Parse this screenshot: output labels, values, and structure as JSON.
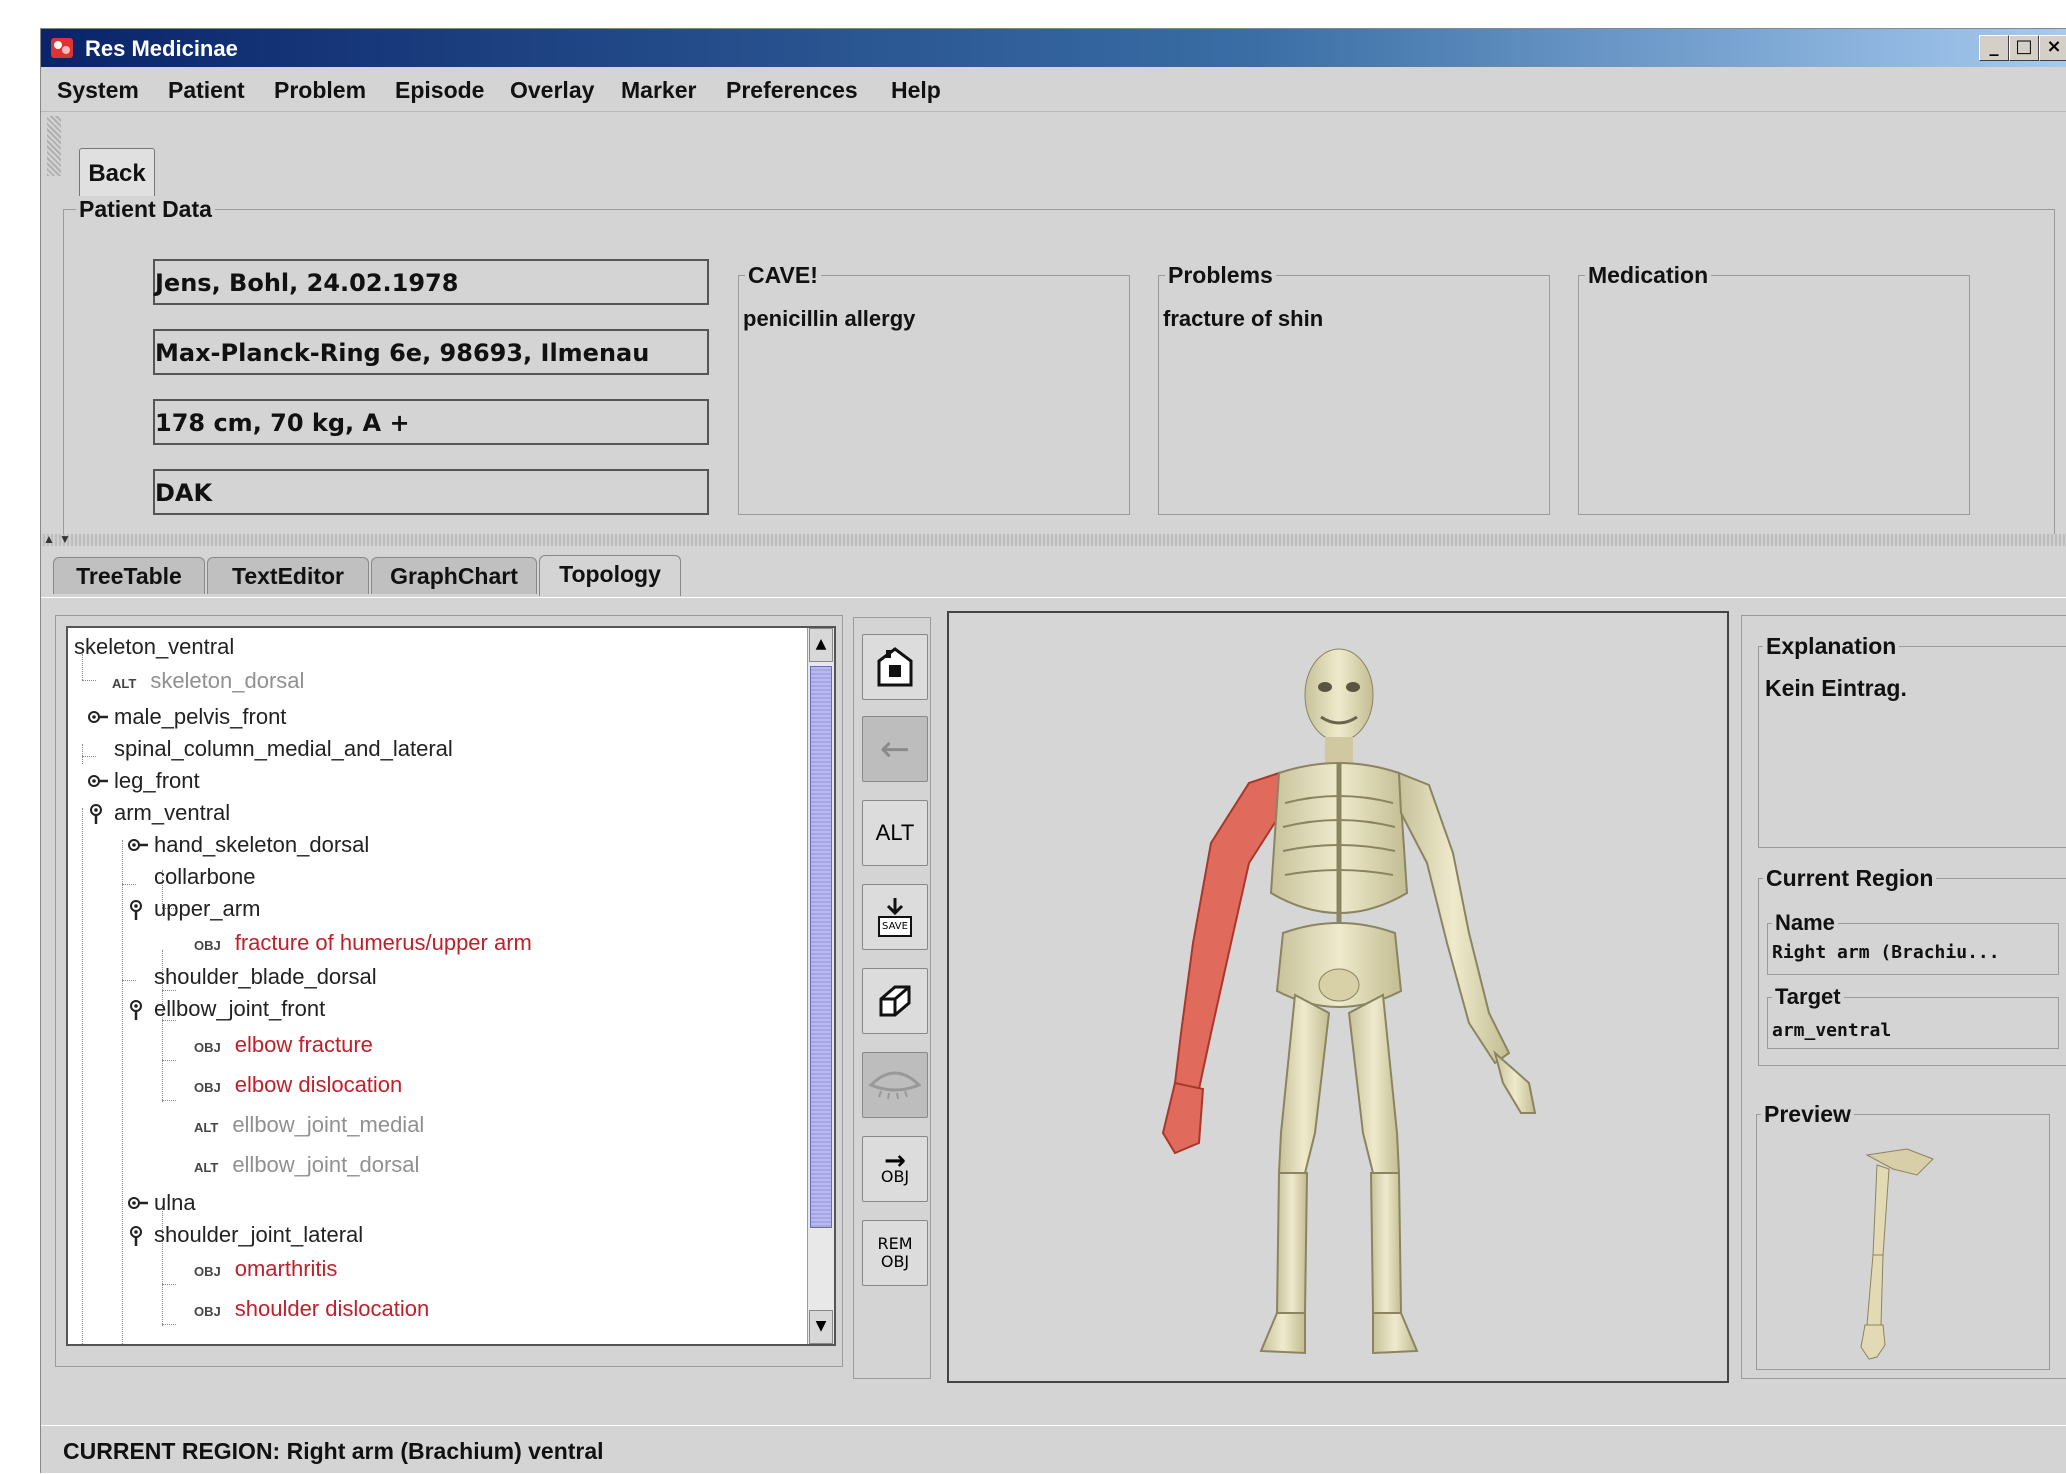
{
  "window": {
    "title": "Res Medicinae",
    "minimize": "_",
    "maximize": "□",
    "close": "×"
  },
  "menu": [
    "System",
    "Patient",
    "Problem",
    "Episode",
    "Overlay",
    "Marker",
    "Preferences",
    "Help"
  ],
  "toolbar": {
    "back_label": "Back"
  },
  "patient_data": {
    "title": "Patient Data",
    "fields": [
      "Jens, Bohl, 24.02.1978",
      "Max-Planck-Ring 6e, 98693, Ilmenau",
      "178 cm, 70 kg, A +",
      "DAK"
    ],
    "cave": {
      "title": "CAVE!",
      "value": "penicillin allergy"
    },
    "problems": {
      "title": "Problems",
      "value": "fracture of shin"
    },
    "medication": {
      "title": "Medication",
      "value": ""
    }
  },
  "tabs": [
    "TreeTable",
    "TextEditor",
    "GraphChart",
    "Topology"
  ],
  "active_tab": "Topology",
  "tree": [
    {
      "label": "skeleton_ventral",
      "type": "node",
      "toggle": "none"
    },
    {
      "label": "skeleton_dorsal",
      "type": "alt",
      "tag": "ALT"
    },
    {
      "label": "male_pelvis_front",
      "type": "node",
      "toggle": "collapsed"
    },
    {
      "label": "spinal_column_medial_and_lateral",
      "type": "node",
      "toggle": "leaf"
    },
    {
      "label": "leg_front",
      "type": "node",
      "toggle": "collapsed"
    },
    {
      "label": "arm_ventral",
      "type": "node",
      "toggle": "expanded"
    },
    {
      "label": "hand_skeleton_dorsal",
      "type": "node",
      "toggle": "collapsed"
    },
    {
      "label": "collarbone",
      "type": "node",
      "toggle": "leaf"
    },
    {
      "label": "upper_arm",
      "type": "node",
      "toggle": "expanded"
    },
    {
      "label": "fracture of humerus/upper arm",
      "type": "obj",
      "tag": "OBJ"
    },
    {
      "label": "shoulder_blade_dorsal",
      "type": "node",
      "toggle": "leaf"
    },
    {
      "label": "ellbow_joint_front",
      "type": "node",
      "toggle": "expanded"
    },
    {
      "label": "elbow fracture",
      "type": "obj",
      "tag": "OBJ"
    },
    {
      "label": "elbow dislocation",
      "type": "obj",
      "tag": "OBJ"
    },
    {
      "label": "ellbow_joint_medial",
      "type": "alt",
      "tag": "ALT"
    },
    {
      "label": "ellbow_joint_dorsal",
      "type": "alt",
      "tag": "ALT"
    },
    {
      "label": "ulna",
      "type": "node",
      "toggle": "collapsed"
    },
    {
      "label": "shoulder_joint_lateral",
      "type": "node",
      "toggle": "expanded"
    },
    {
      "label": "omarthritis",
      "type": "obj",
      "tag": "OBJ"
    },
    {
      "label": "shoulder dislocation",
      "type": "obj",
      "tag": "OBJ"
    }
  ],
  "buttons": {
    "home_icon": "home-icon",
    "back_arrow": "←",
    "alt": "ALT",
    "save": "SAVE",
    "obj_top": "→",
    "obj_bottom": "OBJ",
    "rem_top": "REM",
    "rem_bottom": "OBJ"
  },
  "explanation": {
    "title": "Explanation",
    "value": "Kein Eintrag."
  },
  "current_region": {
    "title": "Current Region",
    "name_title": "Name",
    "name_value": "Right arm (Brachiu...",
    "target_title": "Target",
    "target_value": "arm_ventral"
  },
  "preview": {
    "title": "Preview"
  },
  "status": "CURRENT REGION: Right arm (Brachium) ventral",
  "colors": {
    "obj_text": "#c0202a",
    "alt_text": "#909090",
    "highlight_arm": "#e06a5c",
    "bone": "#e8e2b8"
  }
}
